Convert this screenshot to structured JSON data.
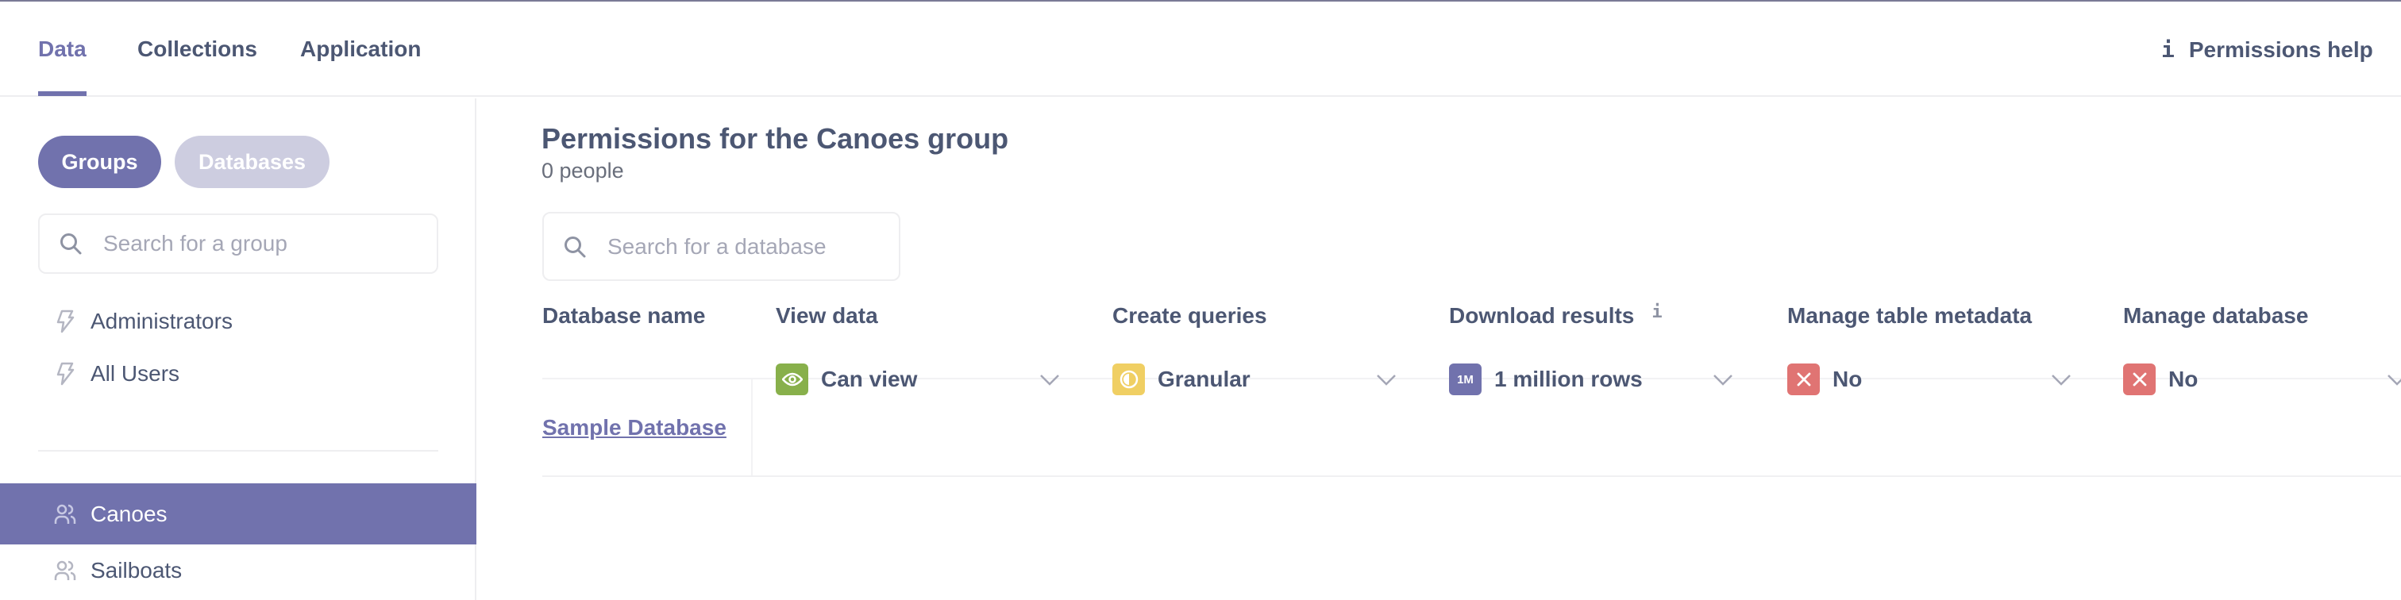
{
  "header": {
    "tabs": [
      {
        "label": "Data",
        "active": true
      },
      {
        "label": "Collections",
        "active": false
      },
      {
        "label": "Application",
        "active": false
      }
    ],
    "help": {
      "icon": "info-icon",
      "label": "Permissions help"
    }
  },
  "sidebar": {
    "toggle": {
      "groups_label": "Groups",
      "databases_label": "Databases",
      "selected": "Groups"
    },
    "search": {
      "placeholder": "Search for a group",
      "value": ""
    },
    "special_groups": [
      {
        "label": "Administrators",
        "icon": "bolt-icon"
      },
      {
        "label": "All Users",
        "icon": "bolt-icon"
      }
    ],
    "groups": [
      {
        "label": "Canoes",
        "icon": "group-icon",
        "selected": true
      },
      {
        "label": "Sailboats",
        "icon": "group-icon",
        "selected": false
      }
    ]
  },
  "main": {
    "title": "Permissions for the Canoes group",
    "subtitle": "0 people",
    "search": {
      "placeholder": "Search for a database",
      "value": ""
    },
    "table": {
      "columns": [
        {
          "label": "Database name"
        },
        {
          "label": "View data"
        },
        {
          "label": "Create queries"
        },
        {
          "label": "Download results",
          "info_icon": "info-icon"
        },
        {
          "label": "Manage table metadata"
        },
        {
          "label": "Manage database"
        }
      ],
      "rows": [
        {
          "database": "Sample Database",
          "view_data": {
            "value": "Can view",
            "icon": "eye-icon",
            "color": "#88B04B"
          },
          "create_queries": {
            "value": "Granular",
            "icon": "partial-circle-icon",
            "color": "#F0CF63"
          },
          "download_results": {
            "value": "1 million rows",
            "icon_text": "1M",
            "color": "#7172AD"
          },
          "manage_table_metadata": {
            "value": "No",
            "icon": "close-icon",
            "color": "#E07473"
          },
          "manage_database": {
            "value": "No",
            "icon": "close-icon",
            "color": "#E07473"
          }
        }
      ]
    }
  },
  "colors": {
    "brand": "#7172AD",
    "text": "#4C5773",
    "pill_inactive": "#CDCDE0"
  }
}
